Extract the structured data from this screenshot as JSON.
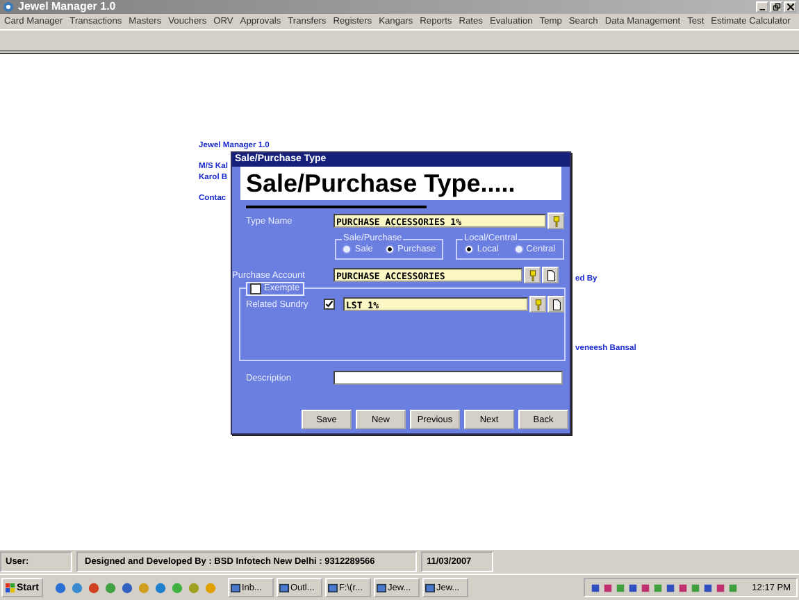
{
  "window": {
    "title": "Jewel Manager 1.0"
  },
  "menu": [
    "Card Manager",
    "Transactions",
    "Masters",
    "Vouchers",
    "ORV",
    "Approvals",
    "Transfers",
    "Registers",
    "Kangars",
    "Reports",
    "Rates",
    "Evaluation",
    "Temp",
    "Search",
    "Data Management",
    "Test",
    "Estimate Calculator"
  ],
  "background": {
    "app_name": "Jewel Manager 1.0",
    "firm_line_1": "M/S Kal",
    "firm_line_2": "Karol B",
    "contact": "Contac",
    "credit_label": "ed By",
    "credit_name": "veneesh Bansal"
  },
  "dialog": {
    "title": "Sale/Purchase Type",
    "heading": "Sale/Purchase Type.....",
    "type_name": {
      "label": "Type Name",
      "value": "PURCHASE ACCESSORIES 1%"
    },
    "sale_purchase": {
      "legend": "Sale/Purchase",
      "options": [
        {
          "label": "Sale",
          "selected": false
        },
        {
          "label": "Purchase",
          "selected": true
        }
      ]
    },
    "local_central": {
      "legend": "Local/Central",
      "options": [
        {
          "label": "Local",
          "selected": true
        },
        {
          "label": "Central",
          "selected": false
        }
      ]
    },
    "account": {
      "label": "Purchase Account",
      "value": "PURCHASE ACCESSORIES"
    },
    "exempt": {
      "label": "Exempte",
      "checked": false
    },
    "sundry": {
      "label": "Related Sundry",
      "checked": true,
      "value": "LST 1%"
    },
    "description": {
      "label": "Description"
    },
    "buttons": [
      "Save",
      "New",
      "Previous",
      "Next",
      "Back"
    ]
  },
  "status_bar": [
    "User:",
    "Designed and Developed By : BSD Infotech New Delhi : 9312289566",
    "11/03/2007"
  ],
  "taskbar": {
    "start": "Start",
    "tasks": [
      "Inb...",
      "Outl...",
      "F:\\(r...",
      "Jew...",
      "Jew..."
    ],
    "clock": "12:17 PM"
  }
}
